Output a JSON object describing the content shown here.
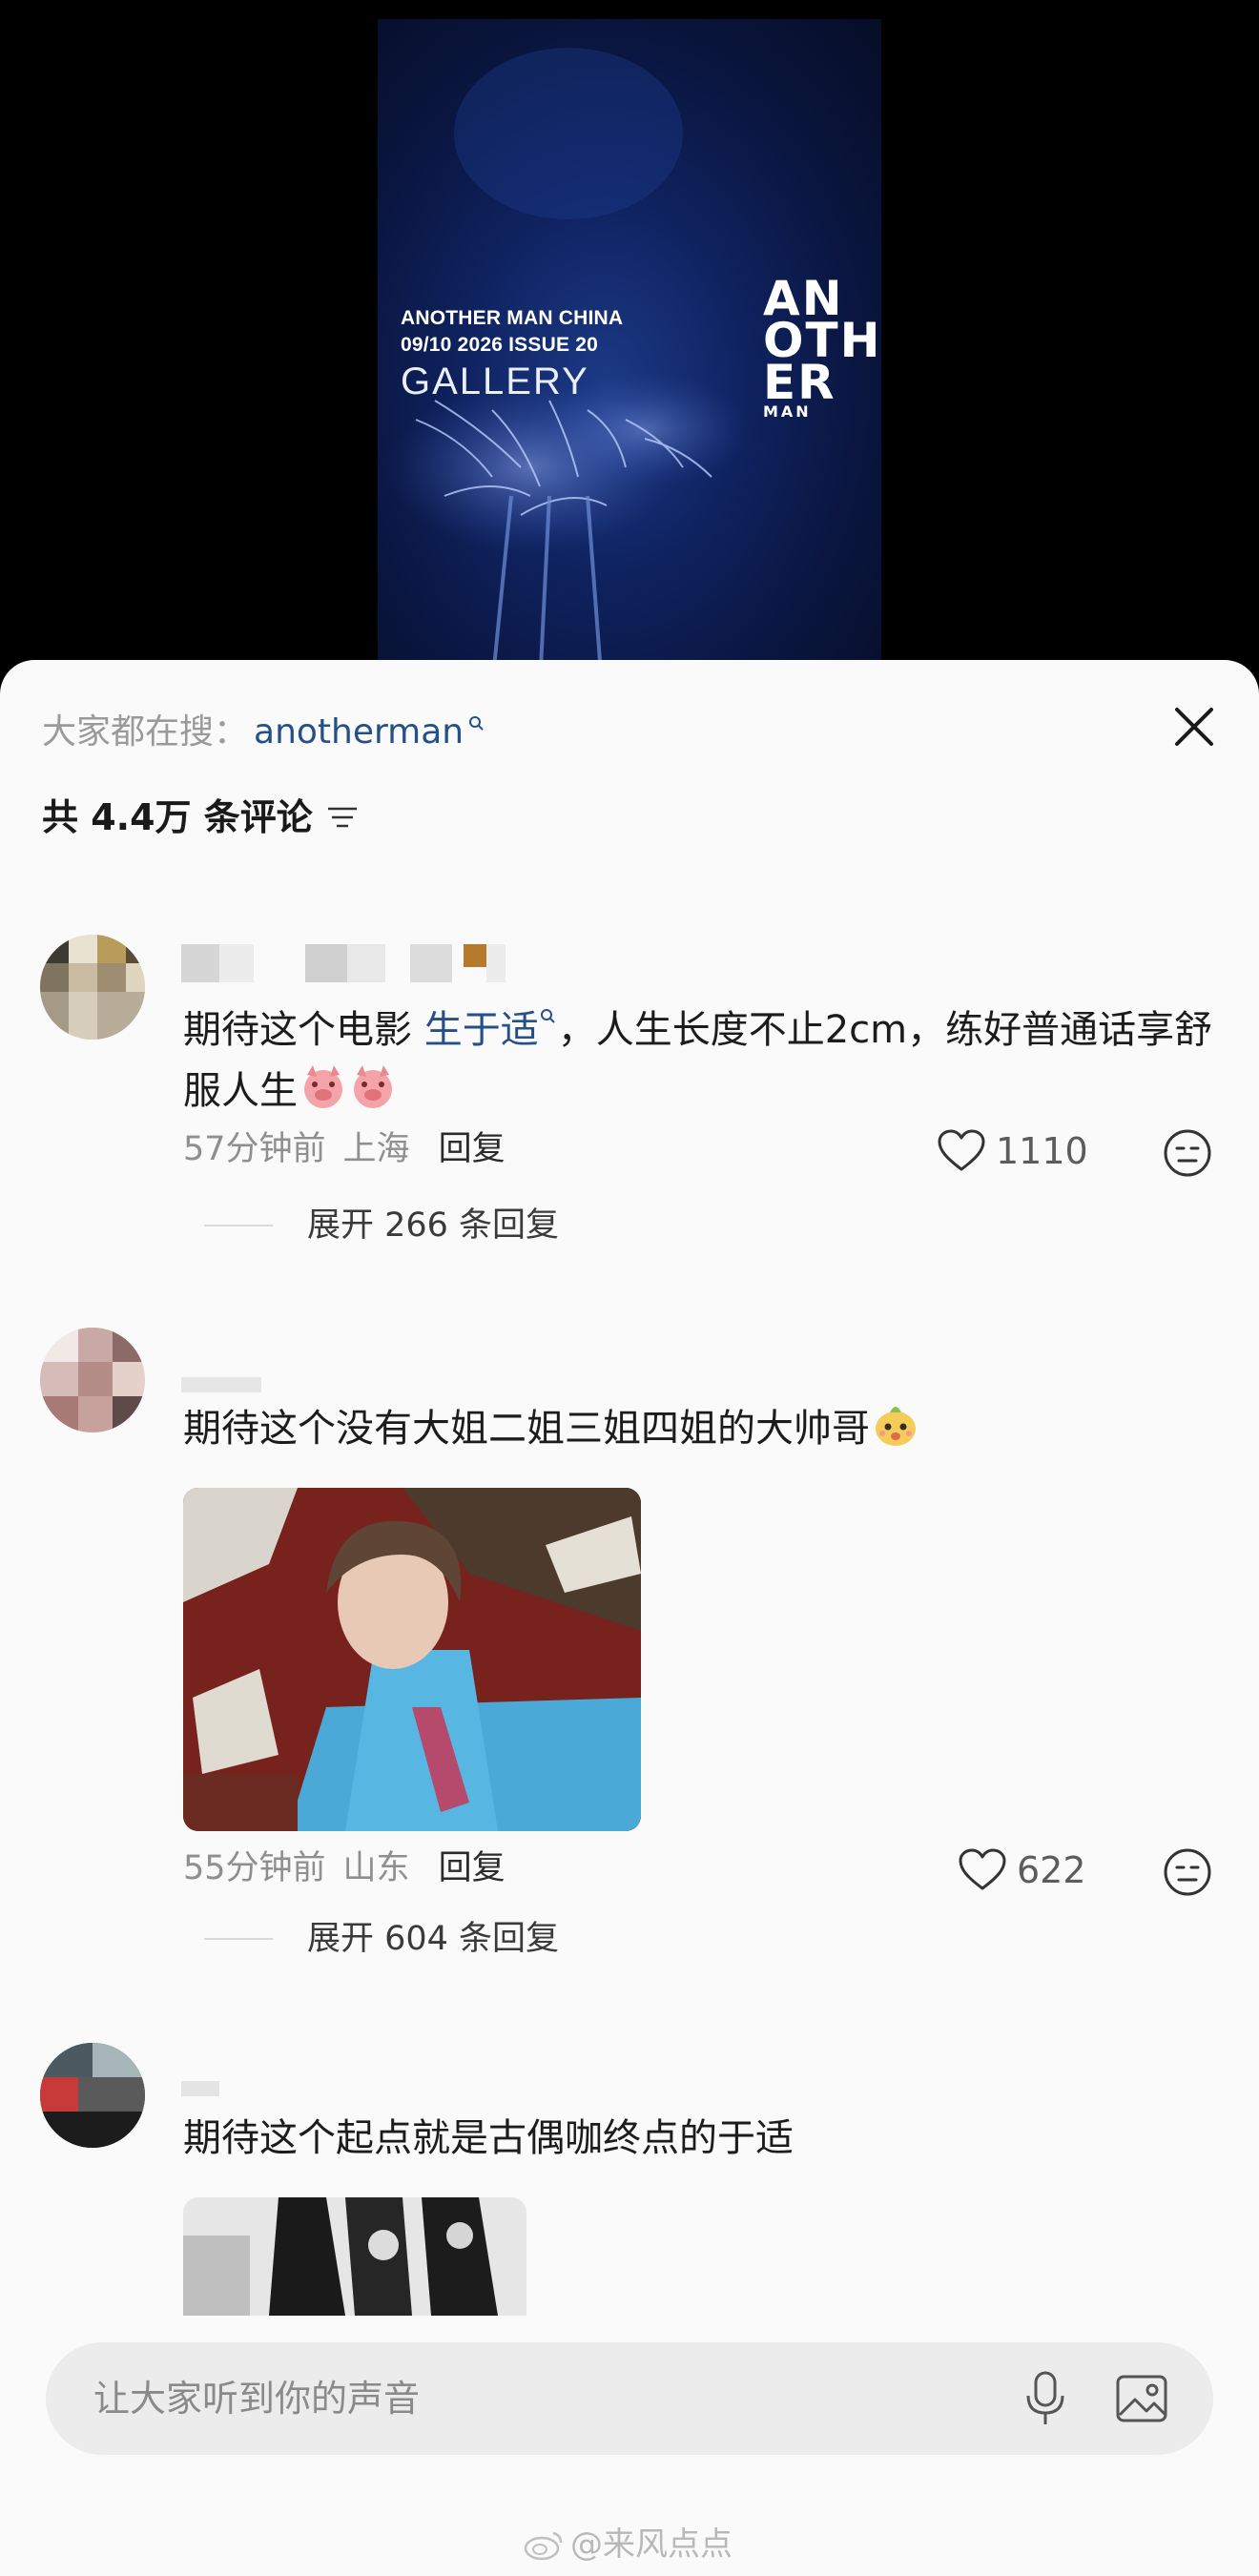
{
  "video": {
    "line1": "ANOTHER MAN CHINA",
    "line2": "09/10 2026 ISSUE 20",
    "line3": "GALLERY",
    "brand_rows": [
      "AN",
      "OTH",
      "ER",
      "MAN"
    ]
  },
  "sheet": {
    "search_prefix": "大家都在搜：",
    "search_term": "anotherman",
    "comment_count": "共 4.4万 条评论"
  },
  "comments": [
    {
      "text_before_link": "期待这个电影 ",
      "topic_link": "生于适",
      "text_after_link": "，人生长度不止2cm，练好普通话享舒服人生",
      "time": "57分钟前",
      "location": "上海",
      "reply_label": "回复",
      "likes": "1110",
      "expand_label": "展开 266 条回复"
    },
    {
      "text": "期待这个没有大姐二姐三姐四姐的大帅哥",
      "time": "55分钟前",
      "location": "山东",
      "reply_label": "回复",
      "likes": "622",
      "expand_label": "展开 604 条回复"
    },
    {
      "text": "期待这个起点就是古偶咖终点的于适"
    }
  ],
  "input": {
    "placeholder": "让大家听到你的声音"
  },
  "watermark": "@来风点点",
  "colors": {
    "link": "#24508a",
    "sheet_bg": "#fafafa",
    "video_bg": "#0f2361"
  }
}
